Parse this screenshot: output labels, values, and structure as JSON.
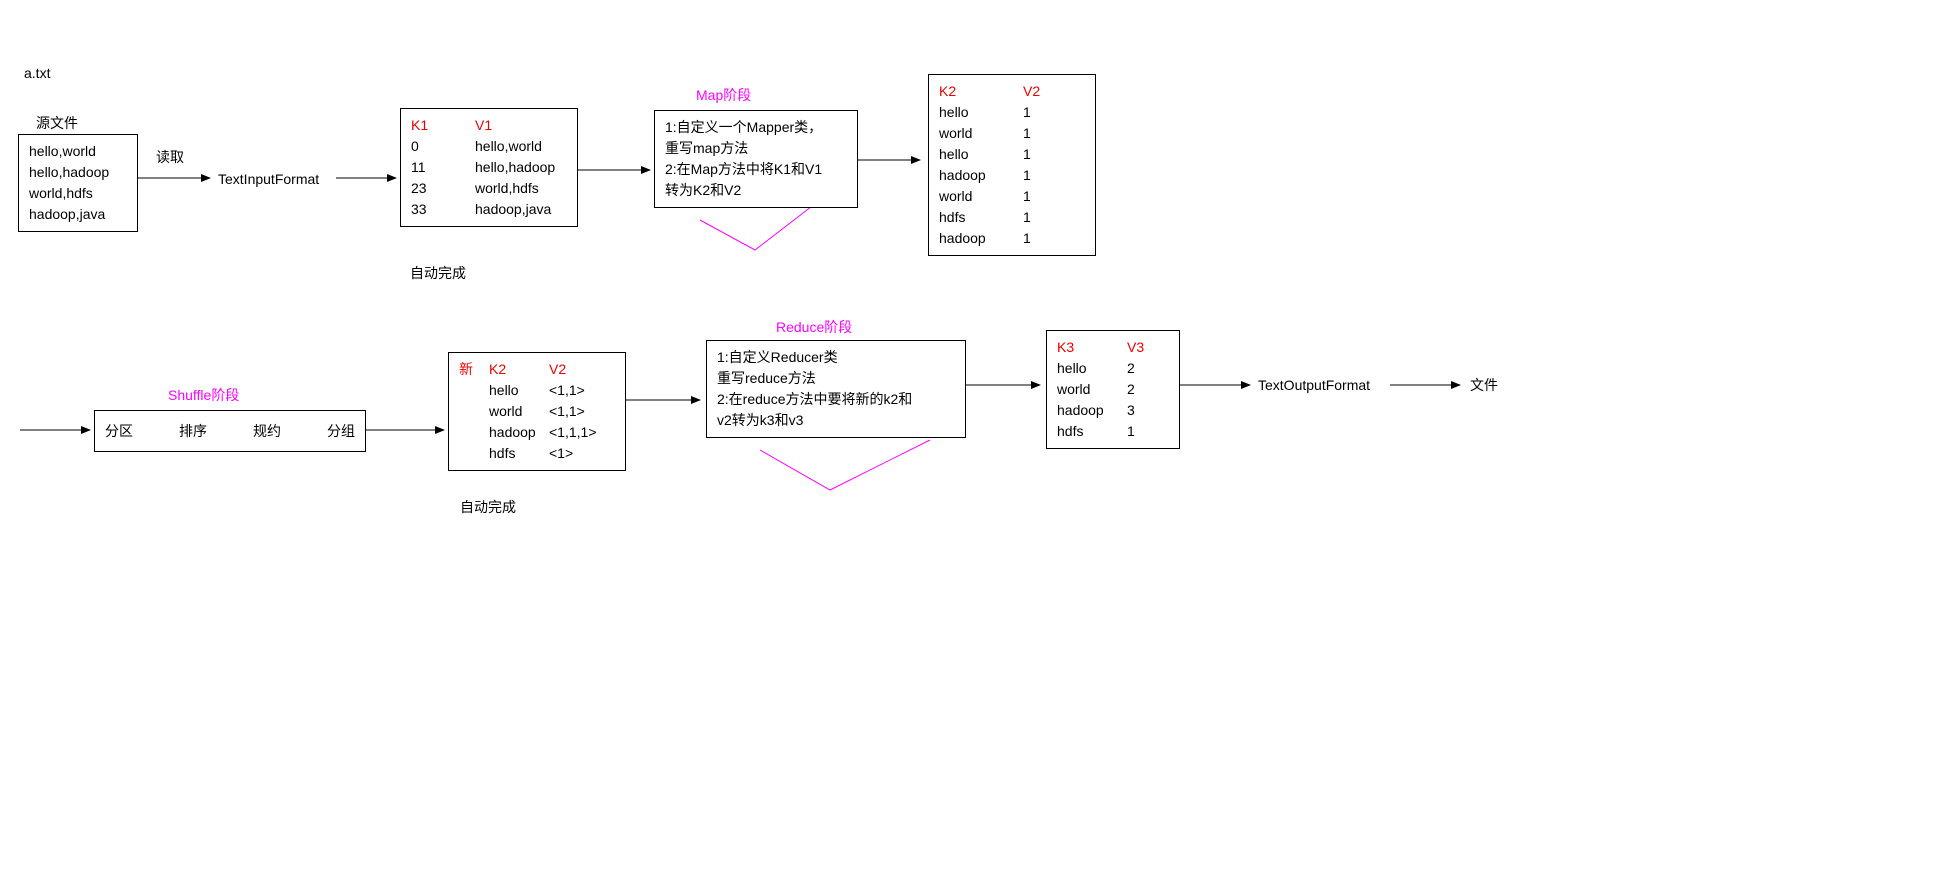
{
  "file_label": "a.txt",
  "source_title": "源文件",
  "source_lines": [
    "hello,world",
    "hello,hadoop",
    "world,hdfs",
    "hadoop,java"
  ],
  "read_label": "读取",
  "text_input_format": "TextInputFormat",
  "auto_label": "自动完成",
  "k1v1": {
    "k": "K1",
    "v": "V1",
    "rows": [
      [
        "0",
        "hello,world"
      ],
      [
        "11",
        "hello,hadoop"
      ],
      [
        "23",
        "world,hdfs"
      ],
      [
        "33",
        "hadoop,java"
      ]
    ]
  },
  "map_stage_title": "Map阶段",
  "map_box": [
    "1:自定义一个Mapper类，",
    "  重写map方法",
    "2:在Map方法中将K1和V1",
    "  转为K2和V2"
  ],
  "k2v2": {
    "k": "K2",
    "v": "V2",
    "rows": [
      [
        "hello",
        "1"
      ],
      [
        "world",
        "1"
      ],
      [
        "hello",
        "1"
      ],
      [
        "hadoop",
        "1"
      ],
      [
        "world",
        "1"
      ],
      [
        "hdfs",
        "1"
      ],
      [
        "hadoop",
        "1"
      ]
    ]
  },
  "shuffle_title": "Shuffle阶段",
  "shuffle_steps": [
    "分区",
    "排序",
    "规约",
    "分组"
  ],
  "new_label": "新",
  "newk2v2": {
    "k": "K2",
    "v": "V2",
    "rows": [
      [
        "hello",
        "<1,1>"
      ],
      [
        "world",
        "<1,1>"
      ],
      [
        "hadoop",
        "<1,1,1>"
      ],
      [
        "hdfs",
        "<1>"
      ]
    ]
  },
  "auto_label2": "自动完成",
  "reduce_stage_title": "Reduce阶段",
  "reduce_box": [
    "1:自定义Reducer类",
    "  重写reduce方法",
    "2:在reduce方法中要将新的k2和",
    "  v2转为k3和v3"
  ],
  "k3v3": {
    "k": "K3",
    "v": "V3",
    "rows": [
      [
        "hello",
        "2"
      ],
      [
        "world",
        "2"
      ],
      [
        "hadoop",
        "3"
      ],
      [
        "hdfs",
        "1"
      ]
    ]
  },
  "text_output_format": "TextOutputFormat",
  "file_out_label": "文件"
}
